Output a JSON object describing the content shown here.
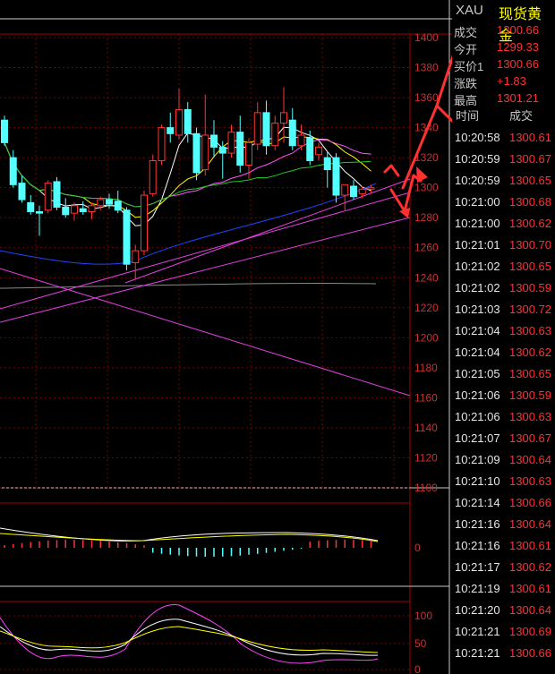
{
  "quote": {
    "symbol": "XAU",
    "name": "现货黄金",
    "rows": [
      {
        "label": "成交",
        "value": "1300.66"
      },
      {
        "label": "今开",
        "value": "1299.33"
      },
      {
        "label": "买价1",
        "value": "1300.66"
      },
      {
        "label": "涨跌",
        "value": "+1.83"
      },
      {
        "label": "最高",
        "value": "1301.21"
      }
    ]
  },
  "ticks": {
    "header_time": "时间",
    "header_price": "成交",
    "rows": [
      {
        "time": "10:20:58",
        "price": "1300.61"
      },
      {
        "time": "10:20:59",
        "price": "1300.67"
      },
      {
        "time": "10:20:59",
        "price": "1300.65"
      },
      {
        "time": "10:21:00",
        "price": "1300.68"
      },
      {
        "time": "10:21:00",
        "price": "1300.62"
      },
      {
        "time": "10:21:01",
        "price": "1300.70"
      },
      {
        "time": "10:21:02",
        "price": "1300.65"
      },
      {
        "time": "10:21:02",
        "price": "1300.59"
      },
      {
        "time": "10:21:03",
        "price": "1300.72"
      },
      {
        "time": "10:21:04",
        "price": "1300.63"
      },
      {
        "time": "10:21:04",
        "price": "1300.62"
      },
      {
        "time": "10:21:05",
        "price": "1300.65"
      },
      {
        "time": "10:21:06",
        "price": "1300.59"
      },
      {
        "time": "10:21:06",
        "price": "1300.63"
      },
      {
        "time": "10:21:07",
        "price": "1300.67"
      },
      {
        "time": "10:21:09",
        "price": "1300.64"
      },
      {
        "time": "10:21:10",
        "price": "1300.63"
      },
      {
        "time": "10:21:14",
        "price": "1300.66"
      },
      {
        "time": "10:21:16",
        "price": "1300.64"
      },
      {
        "time": "10:21:16",
        "price": "1300.61"
      },
      {
        "time": "10:21:17",
        "price": "1300.62"
      },
      {
        "time": "10:21:19",
        "price": "1300.61"
      },
      {
        "time": "10:21:20",
        "price": "1300.64"
      },
      {
        "time": "10:21:21",
        "price": "1300.69"
      },
      {
        "time": "10:21:21",
        "price": "1300.66"
      }
    ]
  },
  "colors": {
    "up": "#ff3232",
    "down": "#54ffff",
    "grid": "#7a0000",
    "axis_text": "#c83232",
    "ma5": "#ffffff",
    "ma10": "#ffff00",
    "ma20": "#ff55ff",
    "ma30": "#22cc22",
    "ma60": "#2244ff",
    "ma120": "#8a8a8a",
    "trendline": "#e040e0",
    "arrow": "#ff3030"
  },
  "chart_data": {
    "type": "candlestick",
    "price_axis": {
      "ticks": [
        1400,
        1380,
        1360,
        1340,
        1320,
        1300,
        1280,
        1260,
        1240,
        1220,
        1200,
        1180,
        1160,
        1140,
        1120,
        1100
      ],
      "ylim": [
        1100,
        1400
      ]
    },
    "candles": [
      {
        "o": 1345,
        "h": 1348,
        "l": 1328,
        "c": 1330
      },
      {
        "o": 1320,
        "h": 1325,
        "l": 1300,
        "c": 1302
      },
      {
        "o": 1303,
        "h": 1308,
        "l": 1290,
        "c": 1292
      },
      {
        "o": 1290,
        "h": 1295,
        "l": 1282,
        "c": 1284
      },
      {
        "o": 1284,
        "h": 1288,
        "l": 1268,
        "c": 1283
      },
      {
        "o": 1285,
        "h": 1305,
        "l": 1283,
        "c": 1303
      },
      {
        "o": 1304,
        "h": 1307,
        "l": 1285,
        "c": 1287
      },
      {
        "o": 1287,
        "h": 1293,
        "l": 1280,
        "c": 1282
      },
      {
        "o": 1283,
        "h": 1290,
        "l": 1278,
        "c": 1288
      },
      {
        "o": 1286,
        "h": 1291,
        "l": 1282,
        "c": 1284
      },
      {
        "o": 1284,
        "h": 1290,
        "l": 1279,
        "c": 1288
      },
      {
        "o": 1288,
        "h": 1294,
        "l": 1285,
        "c": 1292
      },
      {
        "o": 1292,
        "h": 1296,
        "l": 1286,
        "c": 1289
      },
      {
        "o": 1291,
        "h": 1298,
        "l": 1283,
        "c": 1285
      },
      {
        "o": 1285,
        "h": 1287,
        "l": 1245,
        "c": 1249
      },
      {
        "o": 1250,
        "h": 1262,
        "l": 1239,
        "c": 1258
      },
      {
        "o": 1258,
        "h": 1298,
        "l": 1255,
        "c": 1295
      },
      {
        "o": 1296,
        "h": 1322,
        "l": 1294,
        "c": 1318
      },
      {
        "o": 1318,
        "h": 1342,
        "l": 1315,
        "c": 1340
      },
      {
        "o": 1340,
        "h": 1350,
        "l": 1330,
        "c": 1336
      },
      {
        "o": 1335,
        "h": 1366,
        "l": 1332,
        "c": 1352
      },
      {
        "o": 1352,
        "h": 1357,
        "l": 1330,
        "c": 1336
      },
      {
        "o": 1336,
        "h": 1340,
        "l": 1305,
        "c": 1310
      },
      {
        "o": 1312,
        "h": 1362,
        "l": 1308,
        "c": 1335
      },
      {
        "o": 1335,
        "h": 1345,
        "l": 1320,
        "c": 1327
      },
      {
        "o": 1327,
        "h": 1331,
        "l": 1306,
        "c": 1323
      },
      {
        "o": 1323,
        "h": 1342,
        "l": 1320,
        "c": 1337
      },
      {
        "o": 1337,
        "h": 1348,
        "l": 1310,
        "c": 1315
      },
      {
        "o": 1315,
        "h": 1333,
        "l": 1306,
        "c": 1330
      },
      {
        "o": 1329,
        "h": 1357,
        "l": 1325,
        "c": 1350
      },
      {
        "o": 1350,
        "h": 1358,
        "l": 1322,
        "c": 1328
      },
      {
        "o": 1328,
        "h": 1348,
        "l": 1325,
        "c": 1343
      },
      {
        "o": 1343,
        "h": 1367,
        "l": 1330,
        "c": 1350
      },
      {
        "o": 1345,
        "h": 1353,
        "l": 1325,
        "c": 1328
      },
      {
        "o": 1328,
        "h": 1342,
        "l": 1325,
        "c": 1335
      },
      {
        "o": 1333,
        "h": 1338,
        "l": 1315,
        "c": 1318
      },
      {
        "o": 1322,
        "h": 1330,
        "l": 1318,
        "c": 1327
      },
      {
        "o": 1320,
        "h": 1324,
        "l": 1300,
        "c": 1312
      },
      {
        "o": 1320,
        "h": 1323,
        "l": 1290,
        "c": 1295
      },
      {
        "o": 1295,
        "h": 1302,
        "l": 1285,
        "c": 1302
      },
      {
        "o": 1301,
        "h": 1305,
        "l": 1292,
        "c": 1294
      },
      {
        "o": 1296,
        "h": 1301,
        "l": 1293,
        "c": 1299
      },
      {
        "o": 1299,
        "h": 1302,
        "l": 1296,
        "c": 1300
      }
    ],
    "macd": {
      "axis_ticks": [
        0
      ]
    },
    "kdj": {
      "axis_ticks": [
        100,
        50,
        0
      ]
    }
  }
}
